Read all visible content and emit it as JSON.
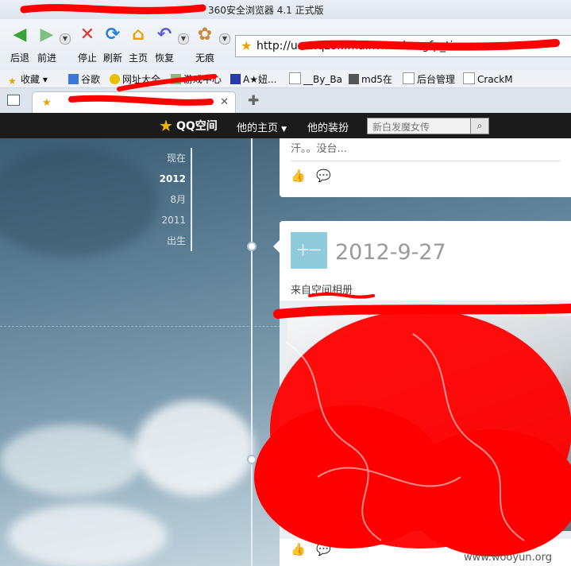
{
  "browser": {
    "window_title": "360安全浏览器 4.1 正式版",
    "toolbar": {
      "back": "后退",
      "forward": "前进",
      "stop": "停止",
      "refresh": "刷新",
      "home": "主页",
      "restore": "恢复",
      "incognito": "无痕"
    },
    "address": "http://user.qzo...main?mode=gfp_tim",
    "favorites": [
      "收藏",
      "谷歌",
      "网址大全",
      "游戏中心",
      "A★妞...",
      "__By_Ba",
      "md5在",
      "后台管理",
      "CrackM"
    ]
  },
  "qzone": {
    "logo": "QQ空间",
    "nav": {
      "home": "他的主页",
      "dress": "他的装扮"
    },
    "search_placeholder": "新白发魔女传"
  },
  "timeline": {
    "years": [
      "现在",
      "2012",
      "8月",
      "2011",
      "出生"
    ],
    "active_index": 1
  },
  "post1": {
    "text": "汗。。没台..."
  },
  "post2": {
    "date": "2012-9-27",
    "icon_glyph": "十一",
    "source": "来自空间相册"
  },
  "footer": {
    "site": "www.wooyun.org"
  },
  "colors": {
    "nav_bg": "#1b1b1b",
    "accent": "#f0b400",
    "scribble": "#ff0000",
    "date_icon": "#8fcbdb"
  }
}
